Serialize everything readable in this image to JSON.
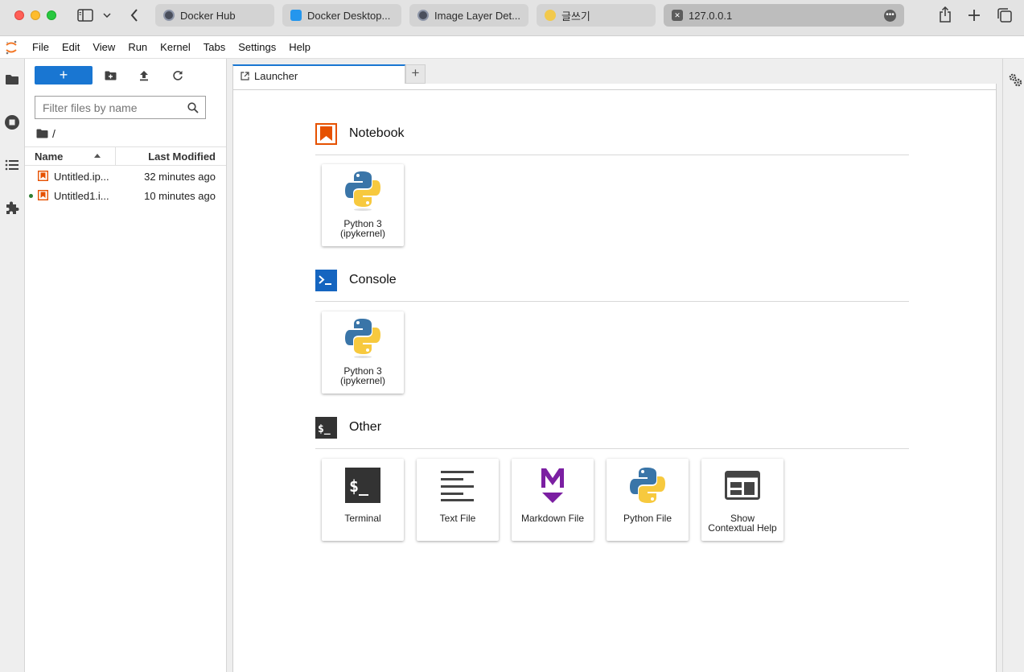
{
  "browser": {
    "tabs": [
      {
        "label": "Docker Hub",
        "favicon": "docker-hub-icon"
      },
      {
        "label": "Docker Desktop...",
        "favicon": "docker-whale-icon"
      },
      {
        "label": "Image Layer Det...",
        "favicon": "docker-hub-icon"
      },
      {
        "label": "글쓰기",
        "favicon": "emoji-icon"
      },
      {
        "label": "127.0.0.1",
        "favicon": "close-x-icon",
        "active": true
      }
    ]
  },
  "menubar": {
    "items": [
      "File",
      "Edit",
      "View",
      "Run",
      "Kernel",
      "Tabs",
      "Settings",
      "Help"
    ]
  },
  "filebrowser": {
    "new_label": "+",
    "filter_placeholder": "Filter files by name",
    "breadcrumb": "/",
    "columns": {
      "name": "Name",
      "modified": "Last Modified"
    },
    "files": [
      {
        "name": "Untitled.ipynb",
        "display": "Untitled.ip...",
        "modified": "32 minutes ago",
        "running": false
      },
      {
        "name": "Untitled1.ipynb",
        "display": "Untitled1.i...",
        "modified": "10 minutes ago",
        "running": true
      }
    ]
  },
  "main": {
    "tab_label": "Launcher",
    "add_tab": "+",
    "sections": {
      "notebook": {
        "title": "Notebook",
        "cards": [
          {
            "label": "Python 3\n(ipykernel)"
          }
        ]
      },
      "console": {
        "title": "Console",
        "cards": [
          {
            "label": "Python 3\n(ipykernel)"
          }
        ]
      },
      "other": {
        "title": "Other",
        "cards": [
          {
            "label": "Terminal"
          },
          {
            "label": "Text File"
          },
          {
            "label": "Markdown File"
          },
          {
            "label": "Python File"
          },
          {
            "label": "Show\nContextual Help"
          }
        ]
      }
    }
  },
  "colors": {
    "accent": "#1976d2",
    "notebook_orange": "#e65100",
    "console_blue": "#1565c0",
    "markdown_purple": "#7b1fa2",
    "running_green": "#2e7d32"
  }
}
